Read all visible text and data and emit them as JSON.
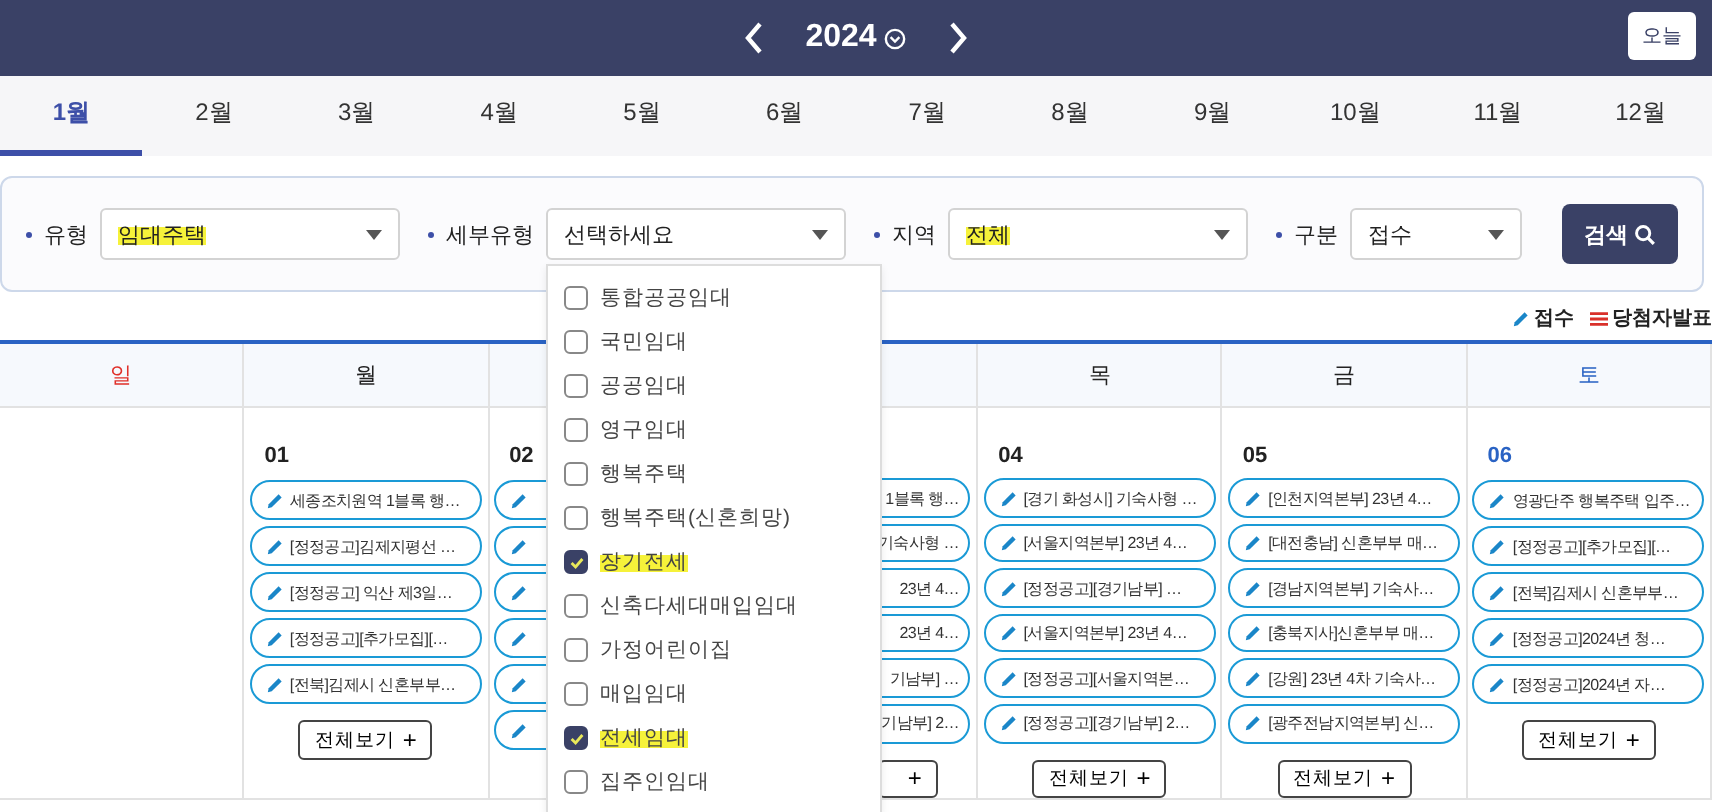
{
  "header": {
    "year": "2024",
    "today_button": "오늘"
  },
  "months": [
    {
      "label": "1월",
      "selected": true
    },
    {
      "label": "2월",
      "selected": false
    },
    {
      "label": "3월",
      "selected": false
    },
    {
      "label": "4월",
      "selected": false
    },
    {
      "label": "5월",
      "selected": false
    },
    {
      "label": "6월",
      "selected": false
    },
    {
      "label": "7월",
      "selected": false
    },
    {
      "label": "8월",
      "selected": false
    },
    {
      "label": "9월",
      "selected": false
    },
    {
      "label": "10월",
      "selected": false
    },
    {
      "label": "11월",
      "selected": false
    },
    {
      "label": "12월",
      "selected": false
    }
  ],
  "filters": [
    {
      "label": "유형",
      "value": "임대주택",
      "highlighted": true
    },
    {
      "label": "세부유형",
      "placeholder": "선택하세요",
      "highlighted": false,
      "open": true
    },
    {
      "label": "지역",
      "value": "전체",
      "highlighted": true
    },
    {
      "label": "구분",
      "value": "접수",
      "highlighted": false
    }
  ],
  "search_button": "검색",
  "dropdown_options": [
    {
      "label": "통합공공임대",
      "checked": false,
      "highlighted": false
    },
    {
      "label": "국민임대",
      "checked": false,
      "highlighted": false
    },
    {
      "label": "공공임대",
      "checked": false,
      "highlighted": false
    },
    {
      "label": "영구임대",
      "checked": false,
      "highlighted": false
    },
    {
      "label": "행복주택",
      "checked": false,
      "highlighted": false
    },
    {
      "label": "행복주택(신혼희망)",
      "checked": false,
      "highlighted": false
    },
    {
      "label": "장기전세",
      "checked": true,
      "highlighted": true
    },
    {
      "label": "신축다세대매입임대",
      "checked": false,
      "highlighted": false
    },
    {
      "label": "가정어린이집",
      "checked": false,
      "highlighted": false
    },
    {
      "label": "매입임대",
      "checked": false,
      "highlighted": false
    },
    {
      "label": "전세임대",
      "checked": true,
      "highlighted": true
    },
    {
      "label": "집주인임대",
      "checked": false,
      "highlighted": false
    }
  ],
  "legend": [
    {
      "kind": "receipt",
      "label": "접수"
    },
    {
      "kind": "winners",
      "label": "당첨자발표"
    }
  ],
  "weekdays": [
    {
      "label": "일",
      "kind": "sun"
    },
    {
      "label": "월",
      "kind": "weekday"
    },
    {
      "kind": "covered"
    },
    {
      "kind": "covered"
    },
    {
      "label": "목",
      "kind": "weekday"
    },
    {
      "label": "금",
      "kind": "weekday"
    },
    {
      "label": "토",
      "kind": "sat"
    }
  ],
  "days": [
    {
      "kind": "sun"
    },
    {
      "kind": "weekday",
      "date": "01",
      "events": [
        {
          "kind": "full",
          "text": "세종조치원역 1블록 행…"
        },
        {
          "kind": "full",
          "text": "[정정공고]김제지평선 …"
        },
        {
          "kind": "full",
          "text": "[정정공고] 익산 제3일…"
        },
        {
          "kind": "full",
          "text": "[정정공고][추가모집][…"
        },
        {
          "kind": "full",
          "text": "[전북]김제시 신혼부부…"
        }
      ],
      "more": "전체보기",
      "plus": "+"
    },
    {
      "kind": "weekday",
      "date": "02",
      "events": [
        {
          "kind": "icon_only"
        },
        {
          "kind": "icon_only"
        },
        {
          "kind": "icon_only"
        },
        {
          "kind": "icon_only"
        },
        {
          "kind": "icon_only"
        },
        {
          "kind": "icon_only"
        }
      ]
    },
    {
      "kind": "weekday",
      "events": [
        {
          "kind": "text_only",
          "text": "1블록 행…"
        },
        {
          "kind": "text_only",
          "text": "기숙사형 …"
        },
        {
          "kind": "text_only",
          "text": "23년 4…"
        },
        {
          "kind": "text_only",
          "text": "23년 4…"
        },
        {
          "kind": "text_only",
          "text": "기남부] …"
        },
        {
          "kind": "text_only",
          "text": "기남부] 2…"
        }
      ],
      "plus": "+"
    },
    {
      "kind": "weekday",
      "date": "04",
      "events": [
        {
          "kind": "full",
          "text": "[경기 화성시] 기숙사형 …"
        },
        {
          "kind": "full",
          "text": "[서울지역본부] 23년 4…"
        },
        {
          "kind": "full",
          "text": "[정정공고][경기남부] …"
        },
        {
          "kind": "full",
          "text": "[서울지역본부] 23년 4…"
        },
        {
          "kind": "full",
          "text": "[정정공고][서울지역본…"
        },
        {
          "kind": "full",
          "text": "[정정공고][경기남부] 2…"
        }
      ],
      "more": "전체보기",
      "plus": "+"
    },
    {
      "kind": "weekday",
      "date": "05",
      "events": [
        {
          "kind": "full",
          "text": "[인천지역본부] 23년 4…"
        },
        {
          "kind": "full",
          "text": "[대전충남] 신혼부부 매…"
        },
        {
          "kind": "full",
          "text": "[경남지역본부] 기숙사…"
        },
        {
          "kind": "full",
          "text": "[충북지사]신혼부부 매…"
        },
        {
          "kind": "full",
          "text": "[강원] 23년 4차 기숙사…"
        },
        {
          "kind": "full",
          "text": "[광주전남지역본부] 신…"
        }
      ],
      "more": "전체보기",
      "plus": "+"
    },
    {
      "kind": "sat",
      "date": "06",
      "events": [
        {
          "kind": "full",
          "text": "영광단주 행복주택 입주…"
        },
        {
          "kind": "full",
          "text": "[정정공고][추가모집][…"
        },
        {
          "kind": "full",
          "text": "[전북]김제시 신혼부부…"
        },
        {
          "kind": "full",
          "text": "[정정공고]2024년 청…"
        },
        {
          "kind": "full",
          "text": "[정정공고]2024년 자…"
        }
      ],
      "more": "전체보기",
      "plus": "+"
    }
  ]
}
